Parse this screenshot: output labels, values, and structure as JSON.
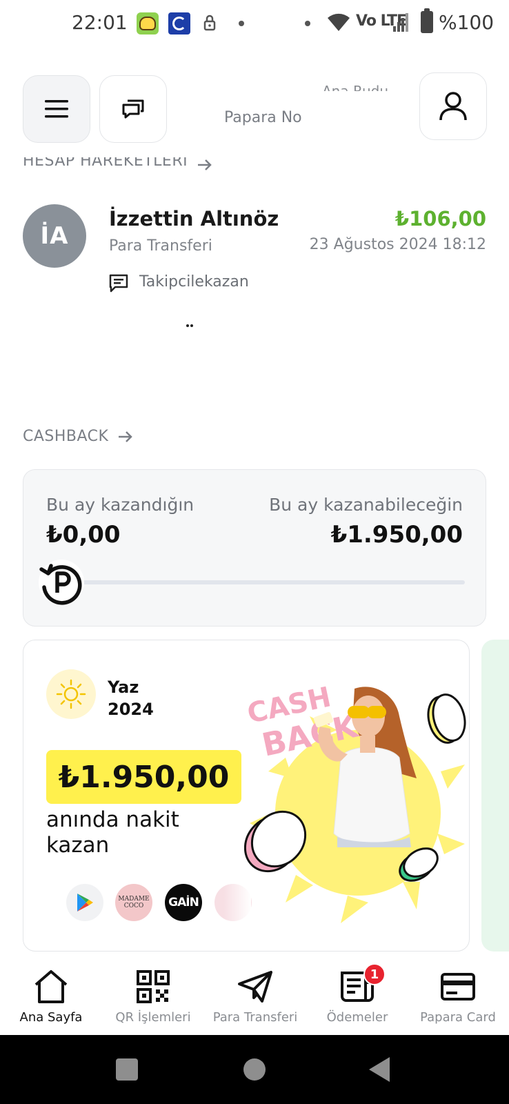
{
  "status_bar": {
    "time": "22:01",
    "network": "Vo LTE",
    "battery": "%100",
    "icons": [
      "app-notification-icon",
      "app-notification-icon",
      "lock-icon",
      "wifi-icon",
      "signal-icon",
      "battery-icon"
    ]
  },
  "header": {
    "menu_icon": "hamburger-menu-icon",
    "messages_icon": "chat-bubbles-icon",
    "profile_icon": "user-icon",
    "marquee_text": "Papara No",
    "marquee_ghost": "Ana Rudu"
  },
  "account_movements": {
    "title": "HESAP HAREKETLERİ",
    "transaction": {
      "initials": "İA",
      "name": "İzzettin Altınöz",
      "type": "Para Transferi",
      "amount": "₺106,00",
      "date": "23 Ağustos 2024 18:12",
      "note": "Takipcilekazan"
    }
  },
  "cashback": {
    "title": "CASHBACK",
    "earned_label": "Bu ay kazandığın",
    "earned_value": "₺0,00",
    "potential_label": "Bu ay kazanabileceğin",
    "potential_value": "₺1.950,00",
    "progress": 0
  },
  "promo": {
    "season_line1": "Yaz",
    "season_line2": "2024",
    "amount": "₺1.950,00",
    "description": "anında nakit kazan",
    "art_text": "CASH BACK",
    "brands": [
      {
        "name": "Google Play"
      },
      {
        "name": "MADAME COCO"
      },
      {
        "name": "GAİN"
      }
    ],
    "colors": {
      "highlight": "#fff04d",
      "sun": "#f3c400",
      "pink": "#f4a9c0",
      "green": "#3bc98a"
    }
  },
  "bottom_nav": {
    "items": [
      {
        "label": "Ana Sayfa",
        "icon": "home-icon",
        "active": true
      },
      {
        "label": "QR İşlemleri",
        "icon": "qr-code-icon",
        "active": false
      },
      {
        "label": "Para Transferi",
        "icon": "send-icon",
        "active": false
      },
      {
        "label": "Ödemeler",
        "icon": "bill-icon",
        "active": false,
        "badge": "1"
      },
      {
        "label": "Papara Card",
        "icon": "card-icon",
        "active": false
      }
    ]
  },
  "colors": {
    "accent_green": "#5db12f",
    "badge_red": "#e8232f",
    "text_primary": "#111111",
    "text_secondary": "#80848a"
  }
}
